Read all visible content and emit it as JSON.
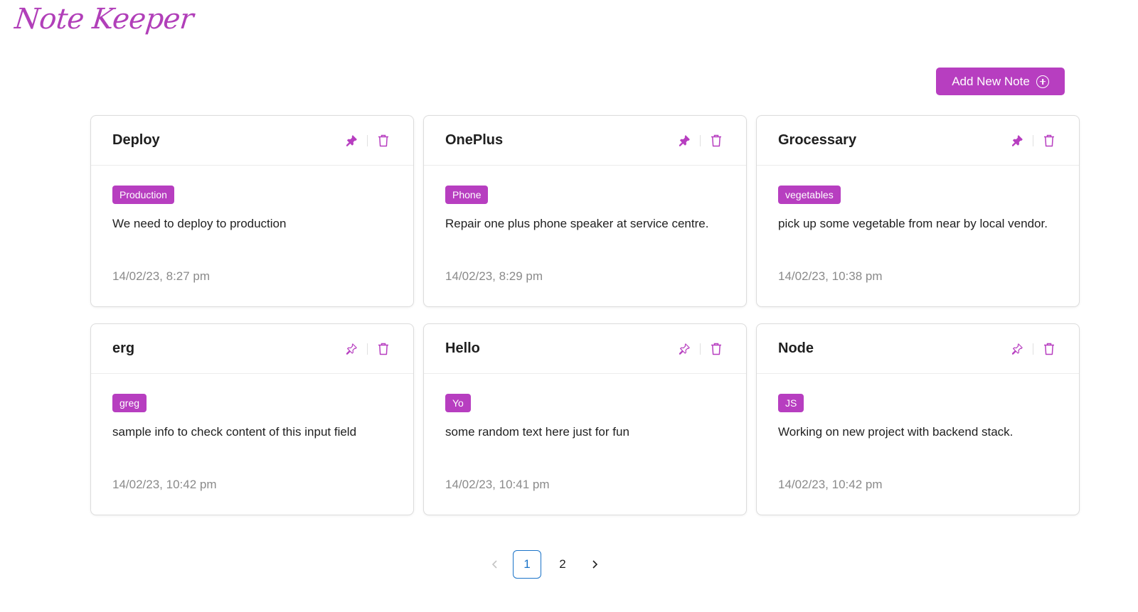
{
  "app": {
    "logo": "Note Keeper"
  },
  "toolbar": {
    "add_label": "Add New Note",
    "add_icon": "plus-circle-icon"
  },
  "colors": {
    "accent": "#b73ec0",
    "page_active": "#1a73c8"
  },
  "notes": [
    {
      "title": "Deploy",
      "tag": "Production",
      "text": "We need to deploy to production",
      "time": "14/02/23, 8:27 pm",
      "pinned": true
    },
    {
      "title": "OnePlus",
      "tag": "Phone",
      "text": "Repair one plus phone speaker at service centre.",
      "time": "14/02/23, 8:29 pm",
      "pinned": true
    },
    {
      "title": "Grocessary",
      "tag": "vegetables",
      "text": "pick up some vegetable from near by local vendor.",
      "time": "14/02/23, 10:38 pm",
      "pinned": true
    },
    {
      "title": "erg",
      "tag": "greg",
      "text": "sample info to check content of this input field",
      "time": "14/02/23, 10:42 pm",
      "pinned": false
    },
    {
      "title": "Hello",
      "tag": "Yo",
      "text": "some random text here just for fun",
      "time": "14/02/23, 10:41 pm",
      "pinned": false
    },
    {
      "title": "Node",
      "tag": "JS",
      "text": "Working on new project with backend stack.",
      "time": "14/02/23, 10:42 pm",
      "pinned": false
    }
  ],
  "pagination": {
    "pages": [
      "1",
      "2"
    ],
    "current": "1",
    "prev_icon": "chevron-left-icon",
    "next_icon": "chevron-right-icon"
  }
}
